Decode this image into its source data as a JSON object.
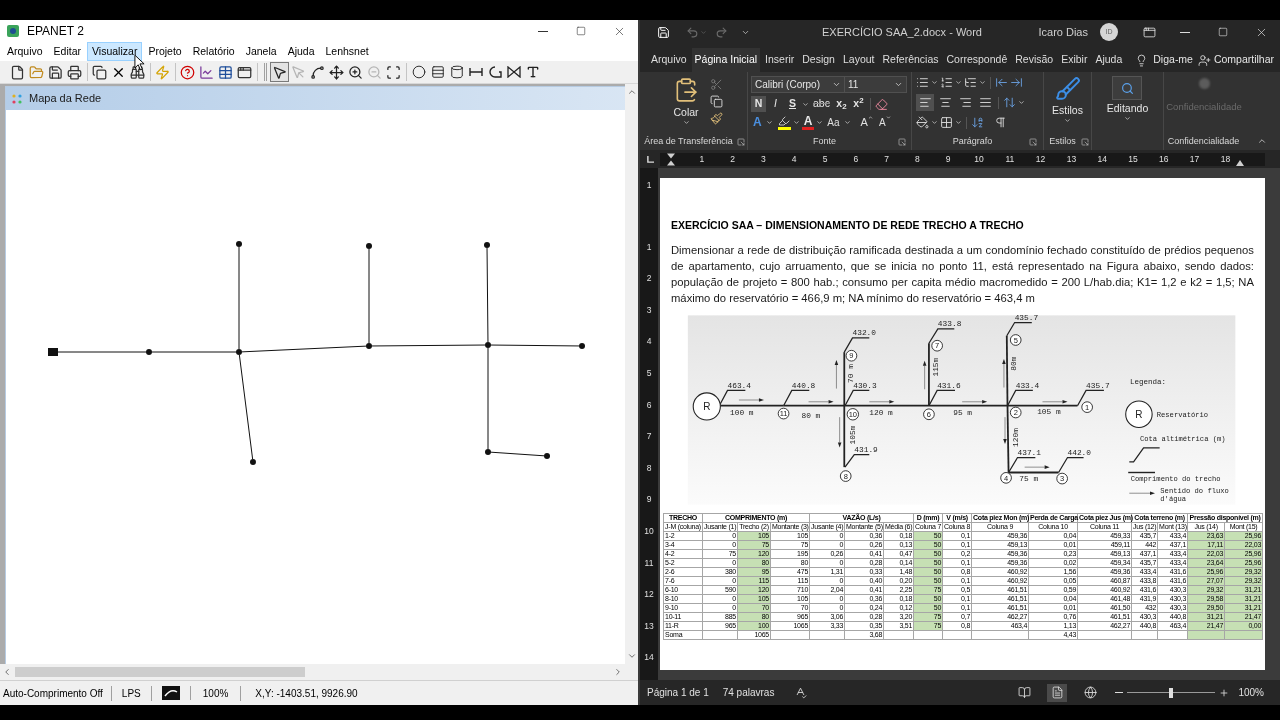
{
  "epanet": {
    "title": "EPANET 2",
    "menu": [
      {
        "label": "Arquivo",
        "highlighted": false
      },
      {
        "label": "Editar",
        "highlighted": false
      },
      {
        "label": "Visualizar",
        "highlighted": true
      },
      {
        "label": "Projeto",
        "highlighted": false
      },
      {
        "label": "Relatório",
        "highlighted": false
      },
      {
        "label": "Janela",
        "highlighted": false
      },
      {
        "label": "Ajuda",
        "highlighted": false
      },
      {
        "label": "Lenhsnet",
        "highlighted": false
      }
    ],
    "map_tools": [
      {
        "selected": true,
        "disabled": false
      },
      {
        "selected": false,
        "disabled": true
      },
      {
        "selected": false,
        "disabled": false
      },
      {
        "selected": false,
        "disabled": false
      },
      {
        "selected": false,
        "disabled": false
      },
      {
        "selected": false,
        "disabled": true
      },
      {
        "selected": false,
        "disabled": false
      }
    ],
    "map_window": {
      "title": "Mapa da Rede"
    },
    "status_bar": {
      "auto_length": "Auto-Comprimento Off",
      "flow_units": "LPS",
      "zoom": "100%",
      "coordinates": "X,Y: -1403.51, 9926.90"
    }
  },
  "word": {
    "title": "EXERCÍCIO SAA_2.docx - Word",
    "user": "Icaro Dias",
    "avatar": "ID",
    "tabs": [
      {
        "label": "Arquivo",
        "selected": false
      },
      {
        "label": "Página Inicial",
        "selected": true
      },
      {
        "label": "Inserir",
        "selected": false
      },
      {
        "label": "Design",
        "selected": false
      },
      {
        "label": "Layout",
        "selected": false
      },
      {
        "label": "Referências",
        "selected": false
      },
      {
        "label": "Correspondê",
        "selected": false
      },
      {
        "label": "Revisão",
        "selected": false
      },
      {
        "label": "Exibir",
        "selected": false
      },
      {
        "label": "Ajuda",
        "selected": false
      }
    ],
    "tell_me": "Diga-me",
    "share": "Compartilhar",
    "clipboard": {
      "paste": "Colar",
      "group": "Área de Transferência"
    },
    "font": {
      "family": "Calibri (Corpo)",
      "size": "11",
      "buttons": [
        {
          "kind": "bold",
          "text": "N",
          "selected": true
        },
        {
          "kind": "italic",
          "text": "I",
          "selected": false
        },
        {
          "kind": "underline",
          "text": "S",
          "selected": false
        },
        {
          "kind": "strike",
          "text": "abc",
          "selected": false
        },
        {
          "kind": "subscript",
          "text": "x$_{2}$",
          "selected": false
        },
        {
          "kind": "superscript",
          "text": "x$^{2}$",
          "selected": false
        }
      ],
      "effects": [
        {
          "kind": "effects",
          "text": "A"
        },
        {
          "kind": "color",
          "text": "A"
        },
        {
          "kind": "case",
          "text": "Aa"
        },
        {
          "kind": "grow",
          "text": "A"
        },
        {
          "kind": "shrink",
          "text": "A"
        }
      ],
      "group": "Fonte"
    },
    "paragraph": {
      "alignment": [
        {
          "selected": true
        },
        {
          "selected": false
        },
        {
          "selected": false
        },
        {
          "selected": false
        }
      ],
      "group": "Parágrafo"
    },
    "styles": {
      "label": "Estilos",
      "group": "Estilos"
    },
    "editing": {
      "label": "Editando"
    },
    "sensitivity": {
      "label": "Confidencialidade",
      "disabled": true,
      "group": "Confidencialidade"
    },
    "ruler": [
      "1",
      "2",
      "3",
      "4",
      "5",
      "6",
      "7",
      "8",
      "9",
      "10",
      "11",
      "12",
      "13",
      "14",
      "15",
      "16",
      "17",
      "18"
    ],
    "vertical_ruler": [
      "1",
      "1",
      "2",
      "3",
      "4",
      "5",
      "6",
      "7",
      "8",
      "9",
      "10",
      "11",
      "12",
      "13",
      "14"
    ],
    "document": {
      "heading": "EXERCÍCIO SAA – DIMENSIONAMENTO DE REDE TRECHO A TRECHO",
      "paragraph": "Dimensionar a rede de distribuição ramificada destinada a um condomínio fechado constituído de prédios pequenos de apartamento, cujo arruamento, que se inicia no ponto 11, está representado na Figura abaixo, sendo dados: população de projeto = 800 hab.; consumo per capita médio macromedido = 200 L/hab.dia; K1= 1,2 e k2 = 1,5; NA máximo do reservatório = 466,9 m; NA mínimo do reservatório = 463,4 m",
      "figure": {
        "nodes": [
          {
            "kind": "junction",
            "label": "5"
          },
          {
            "kind": "junction",
            "label": "7"
          },
          {
            "kind": "junction",
            "label": "9"
          },
          {
            "kind": "reservoir",
            "label": "R"
          },
          {
            "kind": "junction",
            "label": "11"
          },
          {
            "kind": "junction",
            "label": "10"
          },
          {
            "kind": "junction",
            "label": "6"
          },
          {
            "kind": "junction",
            "label": "2"
          },
          {
            "kind": "junction",
            "label": "1"
          },
          {
            "kind": "junction",
            "label": "8"
          },
          {
            "kind": "junction",
            "label": "4"
          },
          {
            "kind": "junction",
            "label": "3"
          }
        ],
        "elevations": [
          "435.7",
          "433.8",
          "432.0",
          "463.4",
          "440.8",
          "430.3",
          "431.6",
          "433.4",
          "435.7",
          "431.9",
          "437.1",
          "442.0"
        ],
        "lengths": [
          "80m",
          "115m",
          "70 m",
          "100 m",
          "80 m",
          "120 m",
          "95 m",
          "105 m",
          "105m",
          "120m",
          "75 m"
        ],
        "legend": {
          "title": "Legenda:",
          "symbol": "R",
          "items": [
            {
              "lines": [
                "Reservatório"
              ]
            },
            {
              "lines": [
                "Cota altimétrica (m)"
              ]
            },
            {
              "lines": [
                "Comprimento do trecho"
              ]
            },
            {
              "lines": [
                "Sentido do fluxo",
                "d'água"
              ]
            }
          ]
        }
      },
      "table": {
        "header_groups": [
          {
            "label": "TRECHO",
            "columns": [
              {
                "label": "J-M (coluna)",
                "highlighted": false
              }
            ]
          },
          {
            "label": "COMPRIMENTO (m)",
            "columns": [
              {
                "label": "Jusante (1)",
                "highlighted": false
              },
              {
                "label": "Trecho (2)",
                "highlighted": true
              },
              {
                "label": "Montante (3)",
                "highlighted": false
              }
            ]
          },
          {
            "label": "VAZÃO (L/s)",
            "columns": [
              {
                "label": "Jusante (4)",
                "highlighted": false
              },
              {
                "label": "Montante (5)",
                "highlighted": false
              },
              {
                "label": "Média (6)",
                "highlighted": false
              }
            ]
          },
          {
            "label": "D (mm)",
            "columns": [
              {
                "label": "Coluna 7",
                "highlighted": true
              }
            ]
          },
          {
            "label": "V (m/s)",
            "columns": [
              {
                "label": "Coluna 8",
                "highlighted": false
              }
            ]
          },
          {
            "label": "Cota piez Mon (m)",
            "columns": [
              {
                "label": "Coluna 9",
                "highlighted": false
              }
            ]
          },
          {
            "label": "Perda de Carga",
            "columns": [
              {
                "label": "Coluna 10",
                "highlighted": false
              }
            ]
          },
          {
            "label": "Cota piez Jus (m)",
            "columns": [
              {
                "label": "Coluna 11",
                "highlighted": false
              }
            ]
          },
          {
            "label": "Cota terreno (m)",
            "columns": [
              {
                "label": "Jus (12)",
                "highlighted": false
              },
              {
                "label": "Mont (13)",
                "highlighted": false
              }
            ]
          },
          {
            "label": "Pressão disponível (m)",
            "columns": [
              {
                "label": "Jus (14)",
                "highlighted": true
              },
              {
                "label": "Mont (15)",
                "highlighted": true
              }
            ]
          }
        ],
        "rows": [
          {
            "cells": [
              "1-2",
              "0",
              "105",
              "105",
              "0",
              "0,36",
              "0,18",
              "50",
              "0,1",
              "459,36",
              "0,04",
              "459,33",
              "435,7",
              "433,4",
              "23,63",
              "25,96"
            ]
          },
          {
            "cells": [
              "3-4",
              "0",
              "75",
              "75",
              "0",
              "0,26",
              "0,13",
              "50",
              "0,1",
              "459,13",
              "0,01",
              "459,11",
              "442",
              "437,1",
              "17,11",
              "22,03"
            ]
          },
          {
            "cells": [
              "4-2",
              "75",
              "120",
              "195",
              "0,26",
              "0,41",
              "0,47",
              "50",
              "0,2",
              "459,36",
              "0,23",
              "459,13",
              "437,1",
              "433,4",
              "22,03",
              "25,96"
            ]
          },
          {
            "cells": [
              "5-2",
              "0",
              "80",
              "80",
              "0",
              "0,28",
              "0,14",
              "50",
              "0,1",
              "459,36",
              "0,02",
              "459,34",
              "435,7",
              "433,4",
              "23,64",
              "25,96"
            ]
          },
          {
            "cells": [
              "2-6",
              "380",
              "95",
              "475",
              "1,31",
              "0,33",
              "1,48",
              "50",
              "0,8",
              "460,92",
              "1,56",
              "459,36",
              "433,4",
              "431,6",
              "25,96",
              "29,32"
            ]
          },
          {
            "cells": [
              "7-6",
              "0",
              "115",
              "115",
              "0",
              "0,40",
              "0,20",
              "50",
              "0,1",
              "460,92",
              "0,05",
              "460,87",
              "433,8",
              "431,6",
              "27,07",
              "29,32"
            ]
          },
          {
            "cells": [
              "6-10",
              "590",
              "120",
              "710",
              "2,04",
              "0,41",
              "2,25",
              "75",
              "0,5",
              "461,51",
              "0,59",
              "460,92",
              "431,6",
              "430,3",
              "29,32",
              "31,21"
            ]
          },
          {
            "cells": [
              "8-10",
              "0",
              "105",
              "105",
              "0",
              "0,36",
              "0,18",
              "50",
              "0,1",
              "461,51",
              "0,04",
              "461,48",
              "431,9",
              "430,3",
              "29,58",
              "31,21"
            ]
          },
          {
            "cells": [
              "9-10",
              "0",
              "70",
              "70",
              "0",
              "0,24",
              "0,12",
              "50",
              "0,1",
              "461,51",
              "0,01",
              "461,50",
              "432",
              "430,3",
              "29,50",
              "31,21"
            ]
          },
          {
            "cells": [
              "10-11",
              "885",
              "80",
              "965",
              "3,06",
              "0,28",
              "3,20",
              "75",
              "0,7",
              "462,27",
              "0,76",
              "461,51",
              "430,3",
              "440,8",
              "31,21",
              "21,47"
            ]
          },
          {
            "cells": [
              "11-R",
              "965",
              "100",
              "1065",
              "3,33",
              "0,35",
              "3,51",
              "75",
              "0,8",
              "463,4",
              "1,13",
              "462,27",
              "440,8",
              "463,4",
              "21,47",
              "0,00"
            ]
          }
        ],
        "total_row": {
          "cells": [
            {
              "text": "Soma",
              "highlighted": false
            },
            {
              "highlighted": false
            },
            {
              "text": "1065",
              "highlighted": false
            },
            {
              "highlighted": false
            },
            {
              "highlighted": false
            },
            {
              "text": "3,68",
              "highlighted": false
            },
            {
              "highlighted": false
            },
            {
              "highlighted": false
            },
            {
              "highlighted": false
            },
            {
              "highlighted": false
            },
            {
              "text": "4,43",
              "highlighted": false
            },
            {
              "highlighted": false
            },
            {
              "highlighted": false
            },
            {
              "highlighted": false
            },
            {
              "highlighted": true
            },
            {
              "highlighted": true
            }
          ]
        }
      }
    },
    "status_bar": {
      "page": "Página 1 de 1",
      "words": "74 palavras",
      "views": [
        {
          "selected": false
        },
        {
          "selected": true
        },
        {
          "selected": false
        }
      ],
      "zoom": {
        "level": 0.5,
        "reading": "100%"
      }
    }
  }
}
